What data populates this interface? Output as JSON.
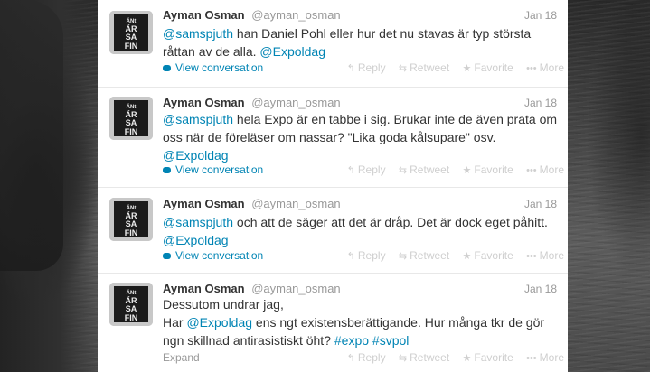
{
  "timeline": {
    "tweets": [
      {
        "avatar_text": [
          "ÄNt",
          "ÄR",
          "SA",
          "FIN"
        ],
        "fullname": "Ayman Osman",
        "username": "@ayman_osman",
        "time": "Jan 18",
        "text_parts": [
          "@samspjuth",
          " han Daniel Pohl eller hur det nu stavas är typ största råttan av de alla. ",
          "@Expoldag"
        ],
        "footer": "View conversation"
      },
      {
        "avatar_text": [
          "ÄNt",
          "ÄR",
          "SA",
          "FIN"
        ],
        "fullname": "Ayman Osman",
        "username": "@ayman_osman",
        "time": "Jan 18",
        "text_parts": [
          "@samspjuth",
          " hela Expo är en tabbe i sig. Brukar inte de även prata om oss när de föreläser om nassar? \"Lika goda kålsupare\" osv. ",
          "@Expoldag"
        ],
        "footer": "View conversation"
      },
      {
        "avatar_text": [
          "ÄNt",
          "ÄR",
          "SA",
          "FIN"
        ],
        "fullname": "Ayman Osman",
        "username": "@ayman_osman",
        "time": "Jan 18",
        "text_parts": [
          "@samspjuth",
          " och att de säger att det är dråp. Det är dock eget påhitt.  ",
          "@Expoldag"
        ],
        "footer": "View conversation"
      },
      {
        "avatar_text": [
          "ÄNt",
          "ÄR",
          "SA",
          "FIN"
        ],
        "fullname": "Ayman Osman",
        "username": "@ayman_osman",
        "time": "Jan 18",
        "text_lines": [
          [
            "Dessutom undrar jag,"
          ],
          [
            "Har ",
            "@Expoldag",
            " ens ngt existensberättigande. Hur många tkr de gör"
          ],
          [
            "ngn skillnad antirasistiskt öht? ",
            "#expo",
            " ",
            "#svpol"
          ]
        ],
        "footer": "Expand"
      }
    ],
    "actions": {
      "reply": "Reply",
      "retweet": "Retweet",
      "favorite": "Favorite",
      "more": "More"
    },
    "icons": {
      "reply": "reply-arrow-icon",
      "retweet": "retweet-icon",
      "favorite": "star-icon",
      "more": "dots-icon",
      "conversation": "speech-bubble-icon"
    },
    "colors": {
      "link": "#0084b4",
      "text": "#333333",
      "muted": "#999999",
      "action": "#cfcfcf"
    }
  }
}
